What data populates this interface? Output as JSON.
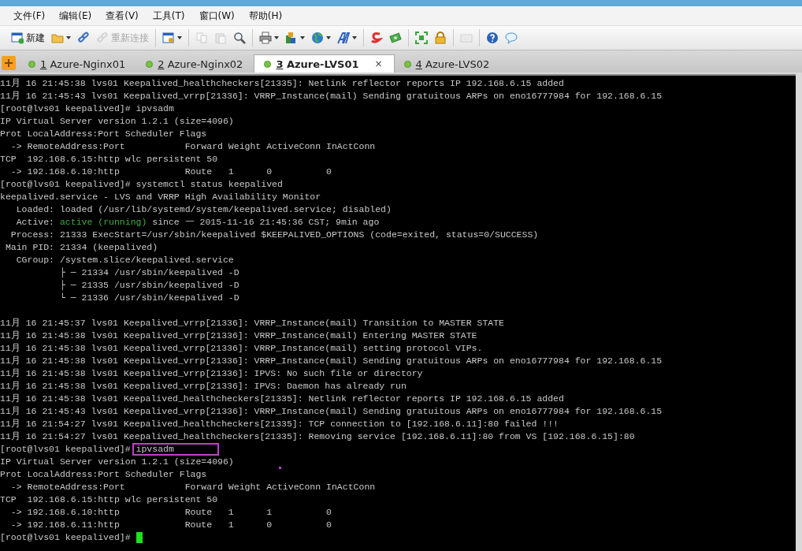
{
  "menu": [
    "文件(F)",
    "编辑(E)",
    "查看(V)",
    "工具(T)",
    "窗口(W)",
    "帮助(H)"
  ],
  "toolbar": {
    "groups": [
      [
        {
          "label": "新建",
          "dropdown": false,
          "disabled": false
        },
        {
          "dropdown": true,
          "disabled": false
        },
        {
          "dropdown": false,
          "disabled": false
        },
        {
          "label": "重新连接",
          "dropdown": false,
          "disabled": true
        }
      ],
      [
        {
          "dropdown": true,
          "disabled": false
        }
      ],
      [
        {
          "dropdown": false,
          "disabled": true
        },
        {
          "dropdown": false,
          "disabled": true
        },
        {
          "dropdown": false,
          "disabled": false
        }
      ],
      [
        {
          "dropdown": true,
          "disabled": false
        },
        {
          "dropdown": true,
          "disabled": false
        },
        {
          "dropdown": true,
          "disabled": false
        },
        {
          "dropdown": true,
          "disabled": false
        }
      ],
      [
        {
          "dropdown": false,
          "disabled": false
        },
        {
          "dropdown": false,
          "disabled": false
        }
      ],
      [
        {
          "dropdown": false,
          "disabled": false
        },
        {
          "dropdown": false,
          "disabled": false
        }
      ],
      [
        {
          "dropdown": false,
          "disabled": true
        }
      ],
      [
        {
          "dropdown": false,
          "disabled": false
        },
        {
          "dropdown": false,
          "disabled": false
        }
      ]
    ]
  },
  "tabs": [
    {
      "number": "1",
      "label": "Azure-Nginx01",
      "selected": false
    },
    {
      "number": "2",
      "label": "Azure-Nginx02",
      "selected": false
    },
    {
      "number": "3",
      "label": "Azure-LVS01",
      "selected": true,
      "close": "×"
    },
    {
      "number": "4",
      "label": "Azure-LVS02",
      "selected": false
    }
  ],
  "terminal": {
    "lines": [
      {
        "kind": "text",
        "text": "11月 16 21:45:38 lvs01 Keepalived_healthcheckers[21335]: Netlink reflector reports IP 192.168.6.15 added"
      },
      {
        "kind": "text",
        "text": "11月 16 21:45:43 lvs01 Keepalived_vrrp[21336]: VRRP_Instance(mail) Sending gratuitous ARPs on eno16777984 for 192.168.6.15"
      },
      {
        "kind": "text",
        "text": "[root@lvs01 keepalived]# ipvsadm"
      },
      {
        "kind": "text",
        "text": "IP Virtual Server version 1.2.1 (size=4096)"
      },
      {
        "kind": "text",
        "text": "Prot LocalAddress:Port Scheduler Flags"
      },
      {
        "kind": "text",
        "text": "  -> RemoteAddress:Port           Forward Weight ActiveConn InActConn"
      },
      {
        "kind": "text",
        "text": "TCP  192.168.6.15:http wlc persistent 50"
      },
      {
        "kind": "text",
        "text": "  -> 192.168.6.10:http            Route   1      0          0"
      },
      {
        "kind": "text",
        "text": "[root@lvs01 keepalived]# systemctl status keepalived"
      },
      {
        "kind": "text",
        "text": "keepalived.service - LVS and VRRP High Availability Monitor"
      },
      {
        "kind": "text",
        "text": "   Loaded: loaded (/usr/lib/systemd/system/keepalived.service; disabled)"
      },
      {
        "kind": "status",
        "before": "   Active: ",
        "status": "active (running)",
        "after": " since 一 2015-11-16 21:45:36 CST; 9min ago"
      },
      {
        "kind": "text",
        "text": "  Process: 21333 ExecStart=/usr/sbin/keepalived $KEEPALIVED_OPTIONS (code=exited, status=0/SUCCESS)"
      },
      {
        "kind": "text",
        "text": " Main PID: 21334 (keepalived)"
      },
      {
        "kind": "text",
        "text": "   CGroup: /system.slice/keepalived.service"
      },
      {
        "kind": "text",
        "text": "           ├ ─ 21334 /usr/sbin/keepalived -D"
      },
      {
        "kind": "text",
        "text": "           ├ ─ 21335 /usr/sbin/keepalived -D"
      },
      {
        "kind": "text",
        "text": "           └ ─ 21336 /usr/sbin/keepalived -D"
      },
      {
        "kind": "blank"
      },
      {
        "kind": "text",
        "text": "11月 16 21:45:37 lvs01 Keepalived_vrrp[21336]: VRRP_Instance(mail) Transition to MASTER STATE"
      },
      {
        "kind": "text",
        "text": "11月 16 21:45:38 lvs01 Keepalived_vrrp[21336]: VRRP_Instance(mail) Entering MASTER STATE"
      },
      {
        "kind": "text",
        "text": "11月 16 21:45:38 lvs01 Keepalived_vrrp[21336]: VRRP_Instance(mail) setting protocol VIPs."
      },
      {
        "kind": "text",
        "text": "11月 16 21:45:38 lvs01 Keepalived_vrrp[21336]: VRRP_Instance(mail) Sending gratuitous ARPs on eno16777984 for 192.168.6.15"
      },
      {
        "kind": "text",
        "text": "11月 16 21:45:38 lvs01 Keepalived_vrrp[21336]: IPVS: No such file or directory"
      },
      {
        "kind": "text",
        "text": "11月 16 21:45:38 lvs01 Keepalived_vrrp[21336]: IPVS: Daemon has already run"
      },
      {
        "kind": "text",
        "text": "11月 16 21:45:38 lvs01 Keepalived_healthcheckers[21335]: Netlink reflector reports IP 192.168.6.15 added"
      },
      {
        "kind": "text",
        "text": "11月 16 21:45:43 lvs01 Keepalived_vrrp[21336]: VRRP_Instance(mail) Sending gratuitous ARPs on eno16777984 for 192.168.6.15"
      },
      {
        "kind": "text",
        "text": "11月 16 21:54:27 lvs01 Keepalived_healthcheckers[21335]: TCP connection to [192.168.6.11]:80 failed !!!"
      },
      {
        "kind": "text",
        "text": "11月 16 21:54:27 lvs01 Keepalived_healthcheckers[21335]: Removing service [192.168.6.11]:80 from VS [192.168.6.15]:80"
      },
      {
        "kind": "text",
        "text": "[root@lvs01 keepalived]# ipvsadm"
      },
      {
        "kind": "text",
        "text": "IP Virtual Server version 1.2.1 (size=4096)"
      },
      {
        "kind": "text",
        "text": "Prot LocalAddress:Port Scheduler Flags"
      },
      {
        "kind": "text",
        "text": "  -> RemoteAddress:Port           Forward Weight ActiveConn InActConn"
      },
      {
        "kind": "text",
        "text": "TCP  192.168.6.15:http wlc persistent 50"
      },
      {
        "kind": "text",
        "text": "  -> 192.168.6.10:http            Route   1      1          0"
      },
      {
        "kind": "text",
        "text": "  -> 192.168.6.11:http            Route   1      0          0"
      },
      {
        "kind": "prompt",
        "text": "[root@lvs01 keepalived]# "
      }
    ]
  }
}
